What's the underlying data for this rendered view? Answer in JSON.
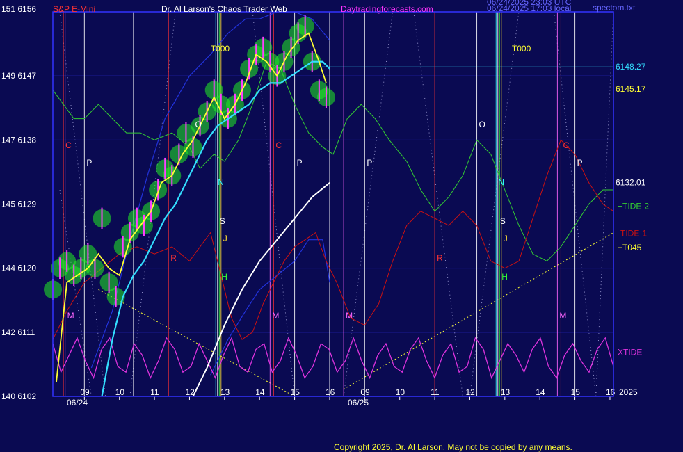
{
  "header": {
    "corner_left": "151 6156",
    "symbol": "S&P E-Mini",
    "title": "Dr. Al Larson's Chaos Trader Web",
    "site": "Daytradingforecasts.com",
    "stamp_utc": "06/24/2025 23:03 UTC",
    "stamp_local": "06/24/2025 17:03 local",
    "file": "spectom.txt"
  },
  "footer": {
    "copyright": "Copyright 2025, Dr. Al Larson. May not be copied by any means.",
    "year": "2025",
    "dates": [
      "06/24",
      "06/25"
    ]
  },
  "colors": {
    "background": "#0a0a52",
    "price_bars": "#ff40ff",
    "bar_glow": "#22ee22",
    "fast_avg": "#ffff33",
    "slow_avg": "#33ddff",
    "tide_plus": "#33cc33",
    "tide_minus": "#cc1111",
    "xtide": "#dd33dd",
    "axis_labels": "#ffffff",
    "frame": "#3333ff"
  },
  "chart_data": {
    "type": "line",
    "title": "Dr. Al Larson's Chaos Trader Web",
    "ylim": [
      6102,
      6156
    ],
    "y_ticks": [
      {
        "left": "140",
        "price": 6102
      },
      {
        "left": "142",
        "price": 6111
      },
      {
        "left": "144",
        "price": 6120
      },
      {
        "left": "145",
        "price": 6129
      },
      {
        "left": "147",
        "price": 6138
      },
      {
        "left": "149",
        "price": 6147
      },
      {
        "left": "151",
        "price": 6156
      }
    ],
    "x_hour_ticks": [
      {
        "label": "09",
        "t": 9
      },
      {
        "label": "10",
        "t": 10
      },
      {
        "label": "11",
        "t": 11
      },
      {
        "label": "12",
        "t": 12
      },
      {
        "label": "13",
        "t": 13
      },
      {
        "label": "14",
        "t": 14
      },
      {
        "label": "15",
        "t": 15
      },
      {
        "label": "16",
        "t": 16
      },
      {
        "label": "09",
        "t": 17
      },
      {
        "label": "10",
        "t": 18
      },
      {
        "label": "11",
        "t": 19
      },
      {
        "label": "12",
        "t": 20
      },
      {
        "label": "13",
        "t": 21
      },
      {
        "label": "14",
        "t": 22
      },
      {
        "label": "15",
        "t": 23
      },
      {
        "label": "16",
        "t": 24
      }
    ],
    "xlim": [
      8.1,
      24.1
    ],
    "right_levels": [
      {
        "label": "6148.27",
        "price": 6148.27
      },
      {
        "label": "6145.17",
        "price": 6145.17
      },
      {
        "label": "6132.01",
        "price": 6132.01
      }
    ],
    "legend": [
      "+TIDE-2",
      "-TIDE-1",
      "+T045",
      "XTIDE"
    ],
    "price": {
      "x": [
        8.1,
        8.3,
        8.5,
        8.7,
        8.9,
        9.1,
        9.3,
        9.5,
        9.7,
        9.9,
        10.1,
        10.3,
        10.5,
        10.7,
        10.9,
        11.1,
        11.3,
        11.5,
        11.7,
        11.9,
        12.1,
        12.3,
        12.5,
        12.7,
        12.9,
        13.1,
        13.3,
        13.5,
        13.7,
        13.9,
        14.1,
        14.3,
        14.5,
        14.7,
        14.9,
        15.1,
        15.3,
        15.5,
        15.7,
        15.9
      ],
      "y": [
        6117,
        6120,
        6121,
        6119,
        6120,
        6122,
        6120,
        6127,
        6118,
        6116,
        6123,
        6125,
        6127,
        6126,
        6128,
        6131,
        6134,
        6133,
        6136,
        6139,
        6137,
        6140,
        6142,
        6145,
        6143,
        6141,
        6143,
        6145,
        6148,
        6150,
        6151,
        6149,
        6147,
        6149,
        6151,
        6153,
        6154,
        6149,
        6145,
        6144
      ]
    },
    "fast_avg": {
      "x": [
        8.2,
        8.5,
        8.8,
        9.1,
        9.4,
        9.7,
        10.0,
        10.3,
        10.6,
        10.9,
        11.2,
        11.5,
        11.8,
        12.1,
        12.4,
        12.7,
        13.0,
        13.3,
        13.6,
        13.9,
        14.2,
        14.5,
        14.8,
        15.1,
        15.4,
        15.7,
        15.9
      ],
      "y": [
        6104,
        6118,
        6119,
        6120,
        6122,
        6120,
        6119,
        6124,
        6126,
        6128,
        6132,
        6133,
        6136,
        6138,
        6141,
        6144,
        6141,
        6143,
        6146,
        6150,
        6149,
        6147,
        6150,
        6152,
        6153,
        6149,
        6146
      ]
    },
    "slow_avg": {
      "x": [
        9.5,
        9.8,
        10.1,
        10.4,
        10.7,
        11.0,
        11.3,
        11.6,
        11.9,
        12.2,
        12.5,
        12.8,
        13.1,
        13.4,
        13.7,
        14.0,
        14.3,
        14.6,
        14.9,
        15.2,
        15.5,
        15.8,
        16.0
      ],
      "y": [
        6102,
        6110,
        6116,
        6119,
        6121,
        6124,
        6127,
        6129,
        6132,
        6135,
        6138,
        6140,
        6141,
        6142,
        6143,
        6145,
        6146,
        6146,
        6147,
        6148,
        6149,
        6149,
        6148
      ]
    },
    "t045": {
      "x": [
        12.1,
        12.5,
        13.0,
        13.5,
        14.0,
        14.5,
        15.0,
        15.5,
        16.0
      ],
      "y": [
        6102,
        6106,
        6112,
        6117,
        6121,
        6124,
        6127,
        6130,
        6132
      ]
    },
    "tide_plus": {
      "x": [
        8.1,
        8.4,
        8.7,
        9.0,
        9.4,
        9.8,
        10.2,
        10.6,
        11.0,
        11.5,
        12.0,
        12.3,
        12.7,
        13.0,
        13.4,
        13.8,
        14.2,
        14.6,
        15.0,
        15.4,
        15.8,
        16.1,
        16.5,
        16.9,
        17.3,
        17.7,
        18.2,
        18.6,
        19.0,
        19.4,
        19.8,
        20.2,
        20.6,
        21.0,
        21.4,
        21.8,
        22.2,
        22.6,
        23.0,
        23.4,
        23.8,
        24.1
      ],
      "y": [
        6145,
        6143,
        6141,
        6141,
        6143,
        6141,
        6139,
        6139,
        6138,
        6139,
        6137,
        6134,
        6136,
        6135,
        6138,
        6143,
        6149,
        6148,
        6143,
        6139,
        6137,
        6136,
        6141,
        6143,
        6141,
        6138,
        6135,
        6131,
        6128,
        6130,
        6133,
        6138,
        6136,
        6131,
        6126,
        6122,
        6121,
        6123,
        6126,
        6129,
        6131,
        6131
      ]
    },
    "tide_minus": {
      "x": [
        8.1,
        8.5,
        9.0,
        9.5,
        10.0,
        10.5,
        11.0,
        11.5,
        12.0,
        12.3,
        12.6,
        12.9,
        13.2,
        13.5,
        13.8,
        14.1,
        14.4,
        14.7,
        15.0,
        15.3,
        15.6,
        15.9,
        16.2,
        16.6,
        17.0,
        17.4,
        17.8,
        18.2,
        18.6,
        19.0,
        19.4,
        19.8,
        20.2,
        20.6,
        21.0,
        21.4,
        21.8,
        22.2,
        22.6,
        23.0,
        23.4,
        23.8,
        24.1
      ],
      "y": [
        6110,
        6114,
        6118,
        6120,
        6122,
        6123,
        6122,
        6123,
        6121,
        6123,
        6125,
        6119,
        6113,
        6110,
        6111,
        6115,
        6118,
        6121,
        6123,
        6124,
        6125,
        6121,
        6118,
        6113,
        6112,
        6115,
        6121,
        6126,
        6128,
        6127,
        6126,
        6128,
        6126,
        6121,
        6120,
        6121,
        6127,
        6133,
        6138,
        6136,
        6132,
        6129,
        6128
      ]
    },
    "xtide_rows": [
      6102,
      6111
    ],
    "xtide": [
      0.8,
      0.3,
      0.6,
      0.9,
      0.5,
      0.2,
      0.7,
      0.9,
      0.4,
      0.3,
      0.8,
      0.6,
      0.2,
      0.5,
      0.9,
      0.7,
      0.3,
      0.4,
      0.8,
      0.5,
      0.2,
      0.6,
      0.9,
      0.4,
      0.3,
      0.7,
      0.8,
      0.3,
      0.5,
      0.9,
      0.6,
      0.2,
      0.4,
      0.8,
      0.7,
      0.3,
      0.5,
      0.9,
      0.5,
      0.2,
      0.6,
      0.8,
      0.4,
      0.3,
      0.7,
      0.9,
      0.5,
      0.2,
      0.6,
      0.8,
      0.3,
      0.4,
      0.9,
      0.7,
      0.2,
      0.5,
      0.8,
      0.6,
      0.3,
      0.7,
      0.9,
      0.4,
      0.2,
      0.6,
      0.8,
      0.5,
      0.3,
      0.7,
      0.9,
      0.4
    ],
    "verticals": [
      {
        "t": 8.4,
        "color": "#ff3333",
        "label": "C"
      },
      {
        "t": 8.45,
        "color": "#ff66ff",
        "label": "M"
      },
      {
        "t": 9.0,
        "color": "#ffffff",
        "label": "P"
      },
      {
        "t": 10.4,
        "color": "#ffffff",
        "label": ""
      },
      {
        "t": 11.4,
        "color": "#ff3333",
        "label": "R"
      },
      {
        "t": 12.1,
        "color": "#ffffff",
        "label": "O"
      },
      {
        "t": 12.75,
        "color": "#33ffff",
        "label": "N"
      },
      {
        "t": 12.8,
        "color": "#ffffff",
        "label": "S"
      },
      {
        "t": 12.85,
        "color": "#33ff33",
        "label": "H"
      },
      {
        "t": 12.9,
        "color": "#ffdd33",
        "label": "J"
      },
      {
        "t": 14.3,
        "color": "#ff66ff",
        "label": "M"
      },
      {
        "t": 14.4,
        "color": "#ff3333",
        "label": "C"
      },
      {
        "t": 15.0,
        "color": "#ffffff",
        "label": "P"
      },
      {
        "t": 16.0,
        "color": "#ffffff",
        "label": ""
      },
      {
        "t": 16.4,
        "color": "#ff66ff",
        "label": "M"
      },
      {
        "t": 17.0,
        "color": "#ffffff",
        "label": "P"
      },
      {
        "t": 19.0,
        "color": "#ff3333",
        "label": "R"
      },
      {
        "t": 20.2,
        "color": "#ffffff",
        "label": "O"
      },
      {
        "t": 20.75,
        "color": "#33ffff",
        "label": "N"
      },
      {
        "t": 20.8,
        "color": "#ffffff",
        "label": "S"
      },
      {
        "t": 20.85,
        "color": "#33ff33",
        "label": "H"
      },
      {
        "t": 20.9,
        "color": "#ffdd33",
        "label": "J"
      },
      {
        "t": 22.5,
        "color": "#ff66ff",
        "label": "M"
      },
      {
        "t": 22.6,
        "color": "#ff3333",
        "label": "C"
      },
      {
        "t": 23.0,
        "color": "#ffffff",
        "label": "P"
      }
    ],
    "t000_labels": [
      {
        "text": "T000",
        "t": 12.6
      },
      {
        "text": "T000",
        "t": 21.2
      }
    ]
  }
}
